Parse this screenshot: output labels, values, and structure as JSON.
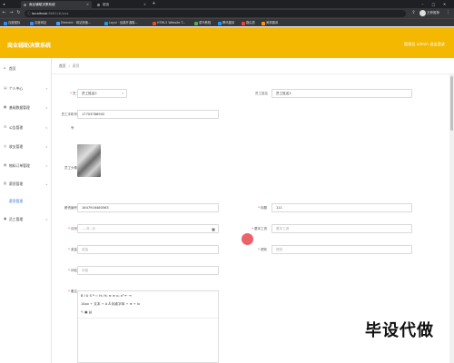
{
  "browser": {
    "tabs": [
      {
        "label": "商业辅助决策系统",
        "active": true
      },
      {
        "label": "前页",
        "active": false
      }
    ],
    "url_host": "localhost",
    "url_rest": ":8081/#/xxx",
    "bookmarks": [
      {
        "label": "百度图标",
        "color": "#2b8cf7"
      },
      {
        "label": "百度网站",
        "color": "#3d8df5"
      },
      {
        "label": "Element · 网站快速...",
        "color": "#409eff"
      },
      {
        "label": "Layui · 经典开源模...",
        "color": "#20a0d8"
      },
      {
        "label": "HTML5 Website T...",
        "color": "#e44d26"
      },
      {
        "label": "菜鸟教程",
        "color": "#4caf50"
      },
      {
        "label": "腾讯翻译",
        "color": "#2196f3"
      },
      {
        "label": "路由表",
        "color": "#f44336"
      },
      {
        "label": "美林翻译",
        "color": "#ff9800"
      }
    ],
    "profile": "王菲推荐"
  },
  "app": {
    "title": "商业辅助决策系统",
    "header_right": "管理员 admin    退出登录"
  },
  "sidebar": {
    "items": [
      {
        "label": "首页",
        "icon": "home-icon",
        "arrow": false
      },
      {
        "label": "个人中心",
        "icon": "user-icon",
        "arrow": true
      },
      {
        "label": "基础数据管理",
        "icon": "grid-icon",
        "arrow": true
      },
      {
        "label": "公告管理",
        "icon": "notice-icon",
        "arrow": true
      },
      {
        "label": "收支管理",
        "icon": "money-icon",
        "arrow": true
      },
      {
        "label": "物料订单管理",
        "icon": "order-icon",
        "arrow": true
      },
      {
        "label": "薪资管理",
        "icon": "salary-icon",
        "arrow": true
      },
      {
        "label": "薪资管理",
        "icon": "",
        "arrow": false,
        "sub": true
      },
      {
        "label": "员工管理",
        "icon": "staff-icon",
        "arrow": true
      }
    ]
  },
  "breadcrumb": {
    "home": "首页",
    "separator": "/",
    "current": "薪资"
  },
  "form": {
    "employee_label": "员工",
    "employee_value": "员工姓名2",
    "employee_name_label": "员工姓名",
    "employee_name_value": "员工姓名2",
    "phone_label": "员工手机号",
    "phone_value": "17703786902",
    "photo_label": "员工头像",
    "salary_no_label": "薪资编号",
    "salary_no_value": "1647916480563",
    "title_label": "标题",
    "title_value": "111",
    "month_label": "月份",
    "month_placeholder": "----年--月",
    "base_label": "基本工资",
    "base_placeholder": "基本工资",
    "bonus_label": "奖金",
    "bonus_placeholder": "奖金",
    "deduct_label": "绩效",
    "deduct_placeholder": "绩效",
    "subsidy_label": "补贴",
    "subsidy_placeholder": "补贴",
    "remark_label": "备注"
  },
  "editor": {
    "row1": "B  I  U  S   ❝  ‹›   H₁  H₂   ≡  ≡   x₂  x²   ⇤  ⇥",
    "row2": "14px  ÷    文本  ÷    A  Ă    标准字体  ÷    ≡  ÷    Ix",
    "row3": "✎  ▣  ▤"
  },
  "watermark": "毕设代做"
}
